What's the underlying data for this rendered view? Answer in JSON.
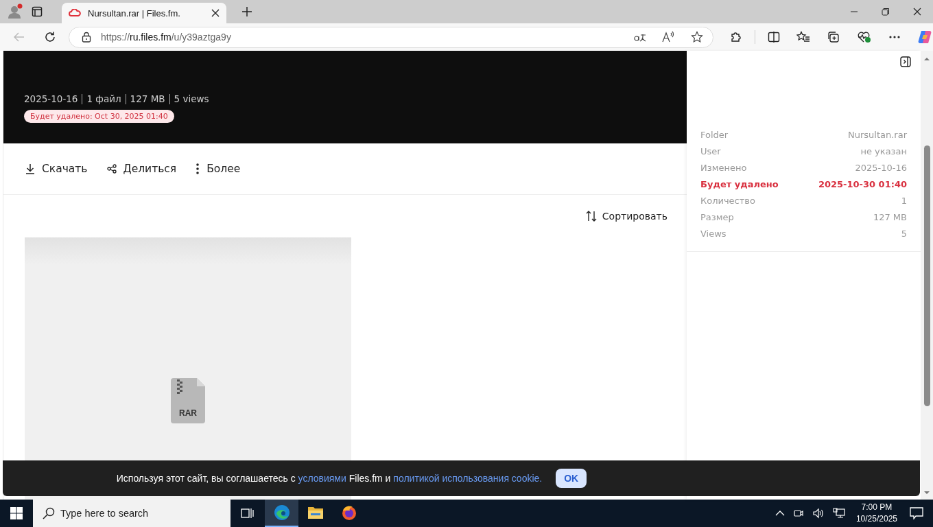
{
  "browser": {
    "tab": {
      "title": "Nursultan.rar | Files.fm.",
      "selected": true
    },
    "url": {
      "scheme": "https://",
      "host": "ru.files.fm",
      "path": "/u/y39aztga9y"
    }
  },
  "header": {
    "meta": [
      "2025-10-16",
      "1 файл",
      "127 MB",
      "5 views"
    ],
    "badge": "Будет удалено: Oct 30, 2025 01:40"
  },
  "actions": [
    {
      "kind": "download",
      "label": "Скачать"
    },
    {
      "kind": "share",
      "label": "Делиться"
    },
    {
      "kind": "more",
      "label": "Более"
    }
  ],
  "sort": {
    "label": "Сортировать"
  },
  "file": {
    "type": "RAR"
  },
  "details": [
    {
      "label": "Folder",
      "value": "Nursultan.rar",
      "highlight": false
    },
    {
      "label": "User",
      "value": "не указан",
      "highlight": false
    },
    {
      "label": "Изменено",
      "value": "2025-10-16",
      "highlight": false
    },
    {
      "label": "Будет удалено",
      "value": "2025-10-30 01:40",
      "highlight": true
    },
    {
      "label": "Количество",
      "value": "1",
      "highlight": false
    },
    {
      "label": "Размер",
      "value": "127 MB",
      "highlight": false
    },
    {
      "label": "Views",
      "value": "5",
      "highlight": false
    }
  ],
  "cookie": {
    "parts": [
      {
        "kind": "text",
        "text": "Используя этот сайт, вы соглашаетесь с "
      },
      {
        "kind": "link",
        "text": "условиями"
      },
      {
        "kind": "text",
        "text": " Files.fm и "
      },
      {
        "kind": "link",
        "text": "политикой использования cookie."
      }
    ],
    "button": "OK"
  },
  "taskbar": {
    "search": {
      "placeholder": "Type here to search"
    },
    "apps": [
      {
        "kind": "edge",
        "selected": true
      },
      {
        "kind": "explorer",
        "selected": false
      },
      {
        "kind": "firefox",
        "selected": false
      }
    ],
    "time": "7:00 PM",
    "date": "10/25/2025"
  }
}
